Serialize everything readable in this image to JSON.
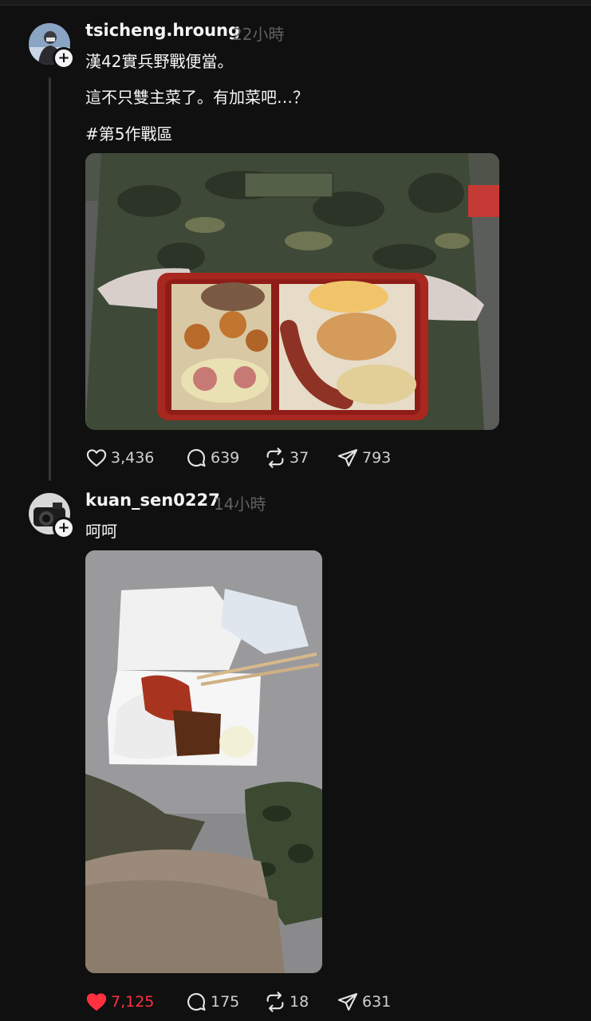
{
  "posts": [
    {
      "username": "tsicheng.hroung",
      "time": "22小時",
      "lines": [
        "漢42實兵野戰便當。",
        "這不只雙主菜了。有加菜吧…？",
        "#第5作戰區"
      ],
      "image_icon": "military-bento-photo",
      "likes": "3,436",
      "comments": "639",
      "reposts": "37",
      "shares": "793",
      "liked": false
    },
    {
      "username": "kuan_sen0227",
      "time": "14小時",
      "lines": [
        "呵呵"
      ],
      "image_icon": "lunchbox-on-ground-photo",
      "likes": "7,125",
      "comments": "175",
      "reposts": "18",
      "shares": "631",
      "liked": true
    }
  ],
  "colors": {
    "background": "#101010",
    "text": "#f3f5f7",
    "muted": "#616161",
    "like_active": "#ff3040"
  },
  "icons": {
    "like": "heart-icon",
    "comment": "comment-icon",
    "repost": "repost-icon",
    "share": "share-icon",
    "follow": "plus-icon"
  }
}
